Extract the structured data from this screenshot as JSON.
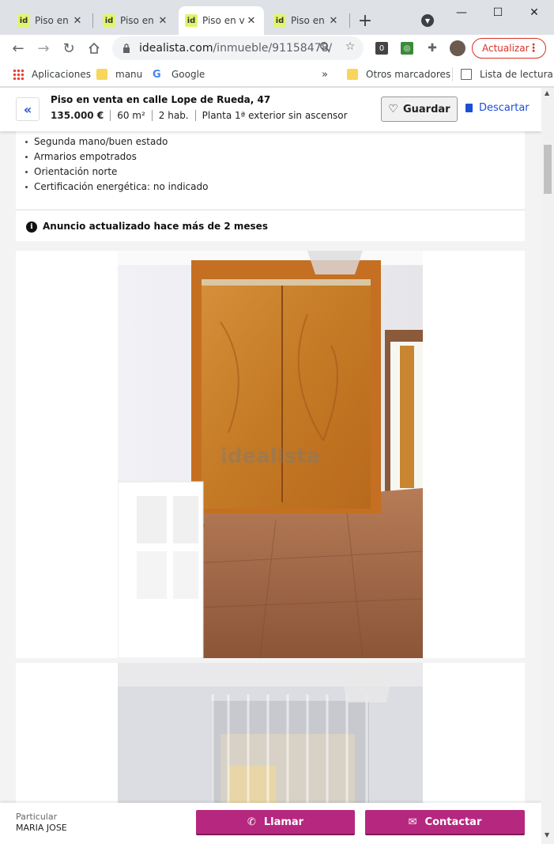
{
  "tabs": [
    {
      "favicon": "id",
      "title": "Piso en v"
    },
    {
      "favicon": "id",
      "title": "Piso en v"
    },
    {
      "favicon": "id",
      "title": "Piso en v"
    },
    {
      "favicon": "id",
      "title": "Piso en v"
    }
  ],
  "toolbar": {
    "url_host": "idealista.com",
    "url_path": "/inmueble/91158478/",
    "update_label": "Actualizar"
  },
  "bookmarks": {
    "apps": "Aplicaciones",
    "manu": "manu",
    "google": "Google",
    "overflow": "»",
    "others": "Otros marcadores",
    "reading_list": "Lista de lectura"
  },
  "header": {
    "title": "Piso en venta en calle Lope de Rueda, 47",
    "facts": [
      "135.000 €",
      "60 m²",
      "2 hab.",
      "Planta 1ª exterior sin ascensor"
    ],
    "save_label": "Guardar",
    "discard_label": "Descartar"
  },
  "features": [
    "Segunda mano/buen estado",
    "Armarios empotrados",
    "Orientación norte",
    "Certificación energética: no indicado"
  ],
  "updated_notice": "Anuncio actualizado hace más de 2 meses",
  "photo": {
    "watermark": "idealista"
  },
  "contact": {
    "seller_type": "Particular",
    "seller_name": "MARIA JOSE",
    "call_label": "Llamar",
    "contact_label": "Contactar"
  },
  "colors": {
    "accent": "#1d4ed8",
    "cta": "#b6287f",
    "update": "#d93025"
  }
}
